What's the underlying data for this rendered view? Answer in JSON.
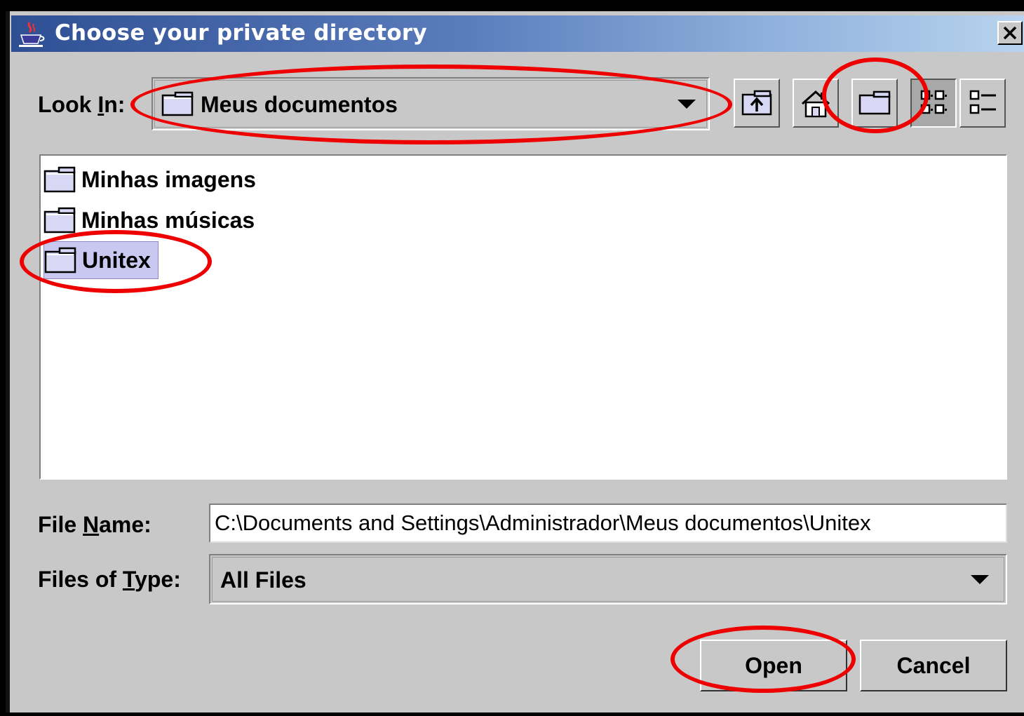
{
  "window": {
    "title": "Choose your private directory"
  },
  "look_in": {
    "label_pre": "Look ",
    "label_mn": "I",
    "label_post": "n:",
    "value": "Meus documentos"
  },
  "toolbar": [
    "up-one-level",
    "home",
    "create-new-folder",
    "list-view",
    "details-view"
  ],
  "files": [
    {
      "name": "Minhas imagens",
      "selected": false
    },
    {
      "name": "Minhas músicas",
      "selected": false
    },
    {
      "name": "Unitex",
      "selected": true
    }
  ],
  "file_name": {
    "label_pre": "File ",
    "label_mn": "N",
    "label_post": "ame:",
    "value": "C:\\Documents and Settings\\Administrador\\Meus documentos\\Unitex"
  },
  "file_type": {
    "label_pre": "Files of ",
    "label_mn": "T",
    "label_post": "ype:",
    "value": "All Files"
  },
  "buttons": {
    "open": "Open",
    "cancel": "Cancel"
  },
  "colors": {
    "title_start": "#2f4f94",
    "title_end": "#b8d3ee",
    "dialog_bg": "#c8c8c8",
    "selection": "#c8c8f0",
    "annotation": "#e00000"
  }
}
